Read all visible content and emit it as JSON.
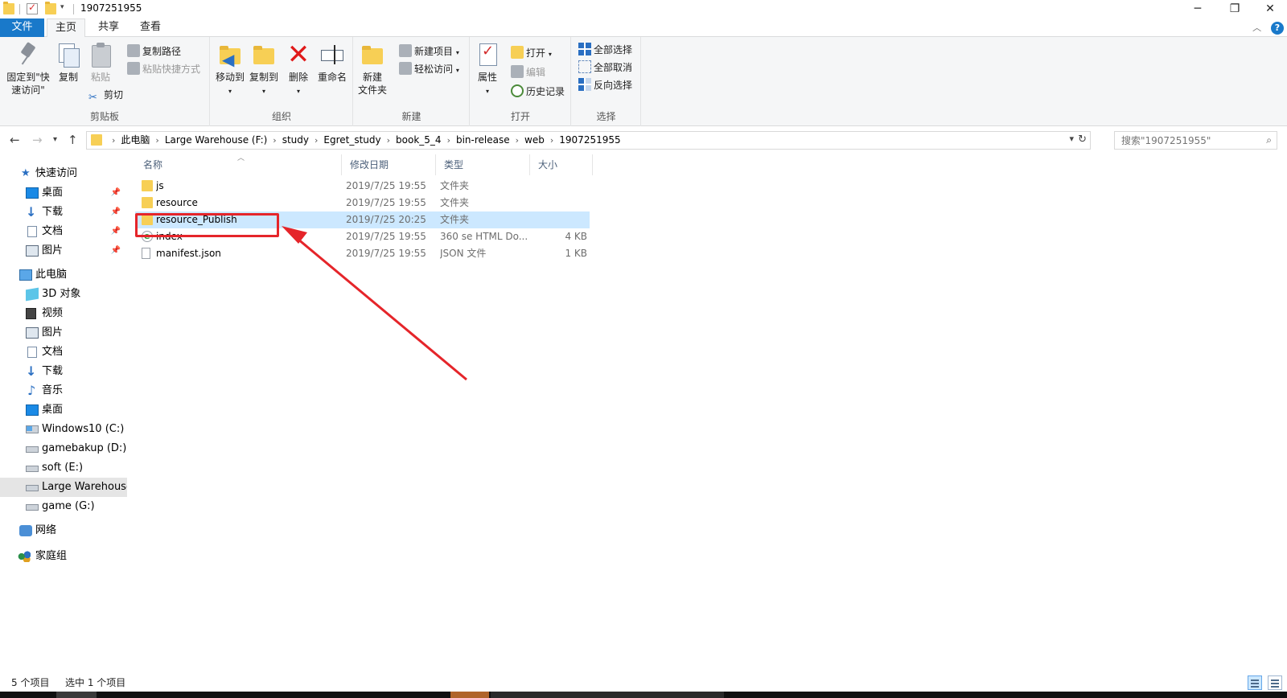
{
  "window": {
    "title": "1907251955",
    "minimize_glyph": "─",
    "maximize_glyph": "❐",
    "close_glyph": "✕"
  },
  "tabs": {
    "file": "文件",
    "home": "主页",
    "share": "共享",
    "view": "查看",
    "help_glyph": "?",
    "collapse_glyph": "︿"
  },
  "ribbon": {
    "clipboard": {
      "label": "剪贴板",
      "pin": "固定到\"快\n速访问\"",
      "pin_line1": "固定到\"快",
      "pin_line2": "速访问\"",
      "copy": "复制",
      "paste": "粘贴",
      "copy_path": "复制路径",
      "paste_shortcut": "粘贴快捷方式",
      "cut": "剪切"
    },
    "organize": {
      "label": "组织",
      "move_to": "移动到",
      "copy_to": "复制到",
      "delete": "删除",
      "rename": "重命名"
    },
    "new": {
      "label": "新建",
      "new_folder_line1": "新建",
      "new_folder_line2": "文件夹",
      "new_item": "新建项目",
      "easy_access": "轻松访问"
    },
    "open": {
      "label": "打开",
      "properties": "属性",
      "open": "打开",
      "edit": "编辑",
      "history": "历史记录"
    },
    "select": {
      "label": "选择",
      "select_all": "全部选择",
      "select_none": "全部取消",
      "invert": "反向选择"
    }
  },
  "address": {
    "crumbs": [
      "此电脑",
      "Large Warehouse (F:)",
      "study",
      "Egret_study",
      "book_5_4",
      "bin-release",
      "web",
      "1907251955"
    ],
    "search_placeholder": "搜索\"1907251955\""
  },
  "nav": {
    "quick_access": "快速访问",
    "quick_items": [
      "桌面",
      "下载",
      "文档",
      "图片"
    ],
    "this_pc": "此电脑",
    "pc_items": [
      "3D 对象",
      "视频",
      "图片",
      "文档",
      "下载",
      "音乐",
      "桌面",
      "Windows10 (C:)",
      "gamebakup (D:)",
      "soft (E:)",
      "Large Warehouse",
      "game (G:)"
    ],
    "network": "网络",
    "homegroup": "家庭组"
  },
  "columns": {
    "name": "名称",
    "date": "修改日期",
    "type": "类型",
    "size": "大小"
  },
  "files": [
    {
      "name": "js",
      "date": "2019/7/25 19:55",
      "type": "文件夹",
      "size": "",
      "icon": "folder-icon"
    },
    {
      "name": "resource",
      "date": "2019/7/25 19:55",
      "type": "文件夹",
      "size": "",
      "icon": "folder-icon"
    },
    {
      "name": "resource_Publish",
      "date": "2019/7/25 20:25",
      "type": "文件夹",
      "size": "",
      "icon": "folder-icon",
      "selected": true
    },
    {
      "name": "index",
      "date": "2019/7/25 19:55",
      "type": "360 se HTML Do...",
      "size": "4 KB",
      "icon": "html-file-icon"
    },
    {
      "name": "manifest.json",
      "date": "2019/7/25 19:55",
      "type": "JSON 文件",
      "size": "1 KB",
      "icon": "json-file-icon"
    }
  ],
  "status": {
    "item_count": "5 个项目",
    "selected_count": "选中 1 个项目"
  },
  "colors": {
    "accent": "#1979ca",
    "selection": "#cce8ff",
    "annotation_red": "#e5252a",
    "folder_yellow": "#f7cf55"
  }
}
